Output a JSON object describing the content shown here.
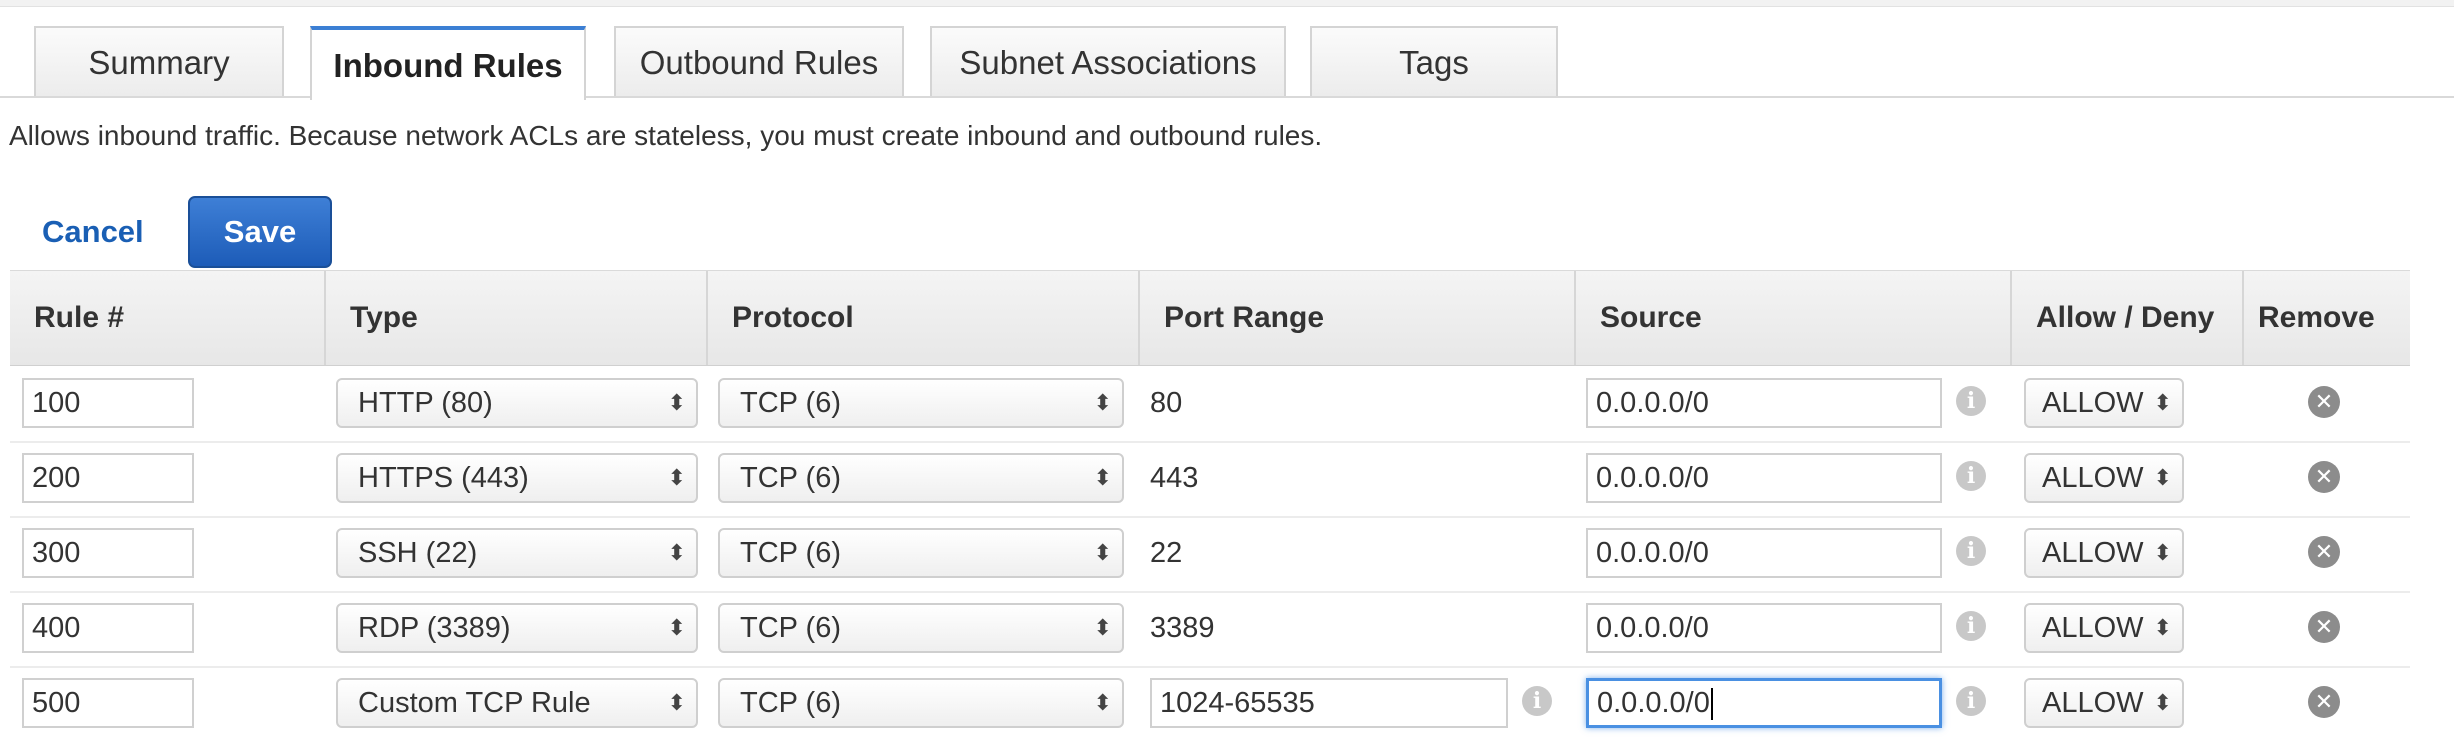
{
  "tabs": [
    {
      "label": "Summary",
      "active": false
    },
    {
      "label": "Inbound Rules",
      "active": true
    },
    {
      "label": "Outbound Rules",
      "active": false
    },
    {
      "label": "Subnet Associations",
      "active": false
    },
    {
      "label": "Tags",
      "active": false
    }
  ],
  "description": "Allows inbound traffic. Because network ACLs are stateless, you must create inbound and outbound rules.",
  "actions": {
    "cancel": "Cancel",
    "save": "Save"
  },
  "table": {
    "headers": [
      "Rule #",
      "Type",
      "Protocol",
      "Port Range",
      "Source",
      "Allow / Deny",
      "Remove"
    ],
    "rows": [
      {
        "rule": "100",
        "type": "HTTP (80)",
        "protocol": "TCP (6)",
        "port_range": "80",
        "source": "0.0.0.0/0",
        "action": "ALLOW"
      },
      {
        "rule": "200",
        "type": "HTTPS (443)",
        "protocol": "TCP (6)",
        "port_range": "443",
        "source": "0.0.0.0/0",
        "action": "ALLOW"
      },
      {
        "rule": "300",
        "type": "SSH (22)",
        "protocol": "TCP (6)",
        "port_range": "22",
        "source": "0.0.0.0/0",
        "action": "ALLOW"
      },
      {
        "rule": "400",
        "type": "RDP (3389)",
        "protocol": "TCP (6)",
        "port_range": "3389",
        "source": "0.0.0.0/0",
        "action": "ALLOW"
      },
      {
        "rule": "500",
        "type": "Custom TCP Rule",
        "protocol": "TCP (6)",
        "port_range": "1024-65535",
        "source": "0.0.0.0/0",
        "action": "ALLOW"
      }
    ]
  },
  "icons": {
    "info": "info-icon",
    "remove": "remove-circle-icon",
    "select_arrows": "updown-arrows-icon"
  },
  "colors": {
    "accent": "#3b7fd4",
    "save_button": "#1d5cb8",
    "link": "#1a5fb4",
    "focus": "#4a90e2"
  }
}
